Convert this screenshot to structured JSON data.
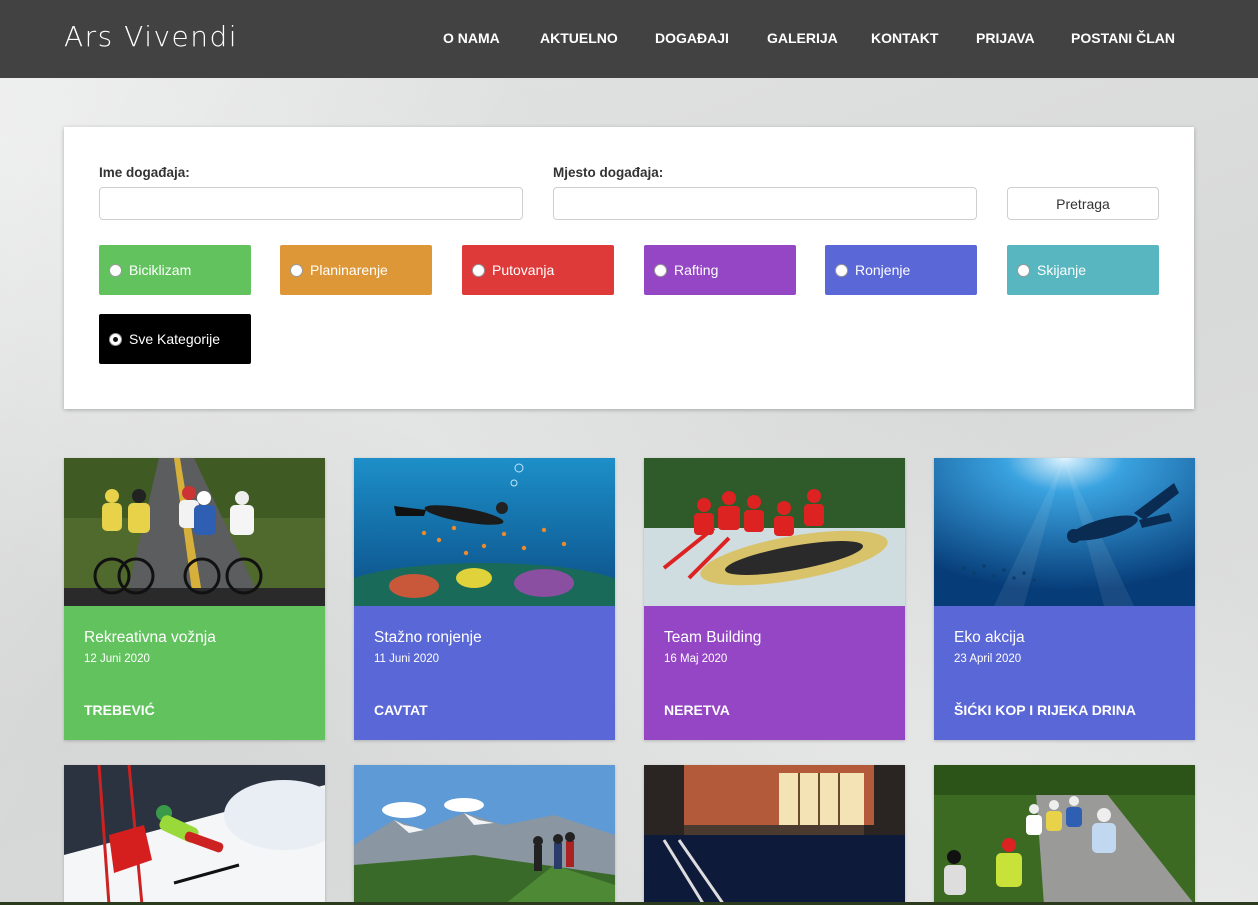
{
  "header": {
    "logo": "Ars Vivendi",
    "nav": [
      "O NAMA",
      "AKTUELNO",
      "DOGAĐAJI",
      "GALERIJA",
      "KONTAKT",
      "PRIJAVA",
      "POSTANI ČLAN"
    ]
  },
  "search": {
    "name_label": "Ime događaja:",
    "name_value": "",
    "place_label": "Mjesto događaja:",
    "place_value": "",
    "button_label": "Pretraga"
  },
  "categories": [
    {
      "label": "Biciklizam",
      "color": "#62c35e",
      "checked": false
    },
    {
      "label": "Planinarenje",
      "color": "#de9736",
      "checked": false
    },
    {
      "label": "Putovanja",
      "color": "#de3a3a",
      "checked": false
    },
    {
      "label": "Rafting",
      "color": "#9446c5",
      "checked": false
    },
    {
      "label": "Ronjenje",
      "color": "#5a67d6",
      "checked": false
    },
    {
      "label": "Skijanje",
      "color": "#57b6bf",
      "checked": false
    },
    {
      "label": "Sve Kategorije",
      "color": "#000000",
      "checked": true
    }
  ],
  "events": [
    {
      "title": "Rekreativna vožnja",
      "date": "12 Juni 2020",
      "place": "TREBEVIĆ",
      "color": "#62c35e",
      "image": "cycling-race-photo"
    },
    {
      "title": "Stažno ronjenje",
      "date": "11 Juni 2020",
      "place": "CAVTAT",
      "color": "#5a67d6",
      "image": "coral-reef-diver-photo"
    },
    {
      "title": "Team Building",
      "date": "16 Maj 2020",
      "place": "NERETVA",
      "color": "#9446c5",
      "image": "rafting-photo"
    },
    {
      "title": "Eko akcija",
      "date": "23 April 2020",
      "place": "ŠIĆKI KOP I RIJEKA DRINA",
      "color": "#5a67d6",
      "image": "underwater-diver-photo"
    }
  ],
  "events_row2": [
    {
      "image": "ski-slalom-photo"
    },
    {
      "image": "mountain-hikers-photo"
    },
    {
      "image": "indoor-pool-photo"
    },
    {
      "image": "road-cyclists-photo"
    }
  ]
}
